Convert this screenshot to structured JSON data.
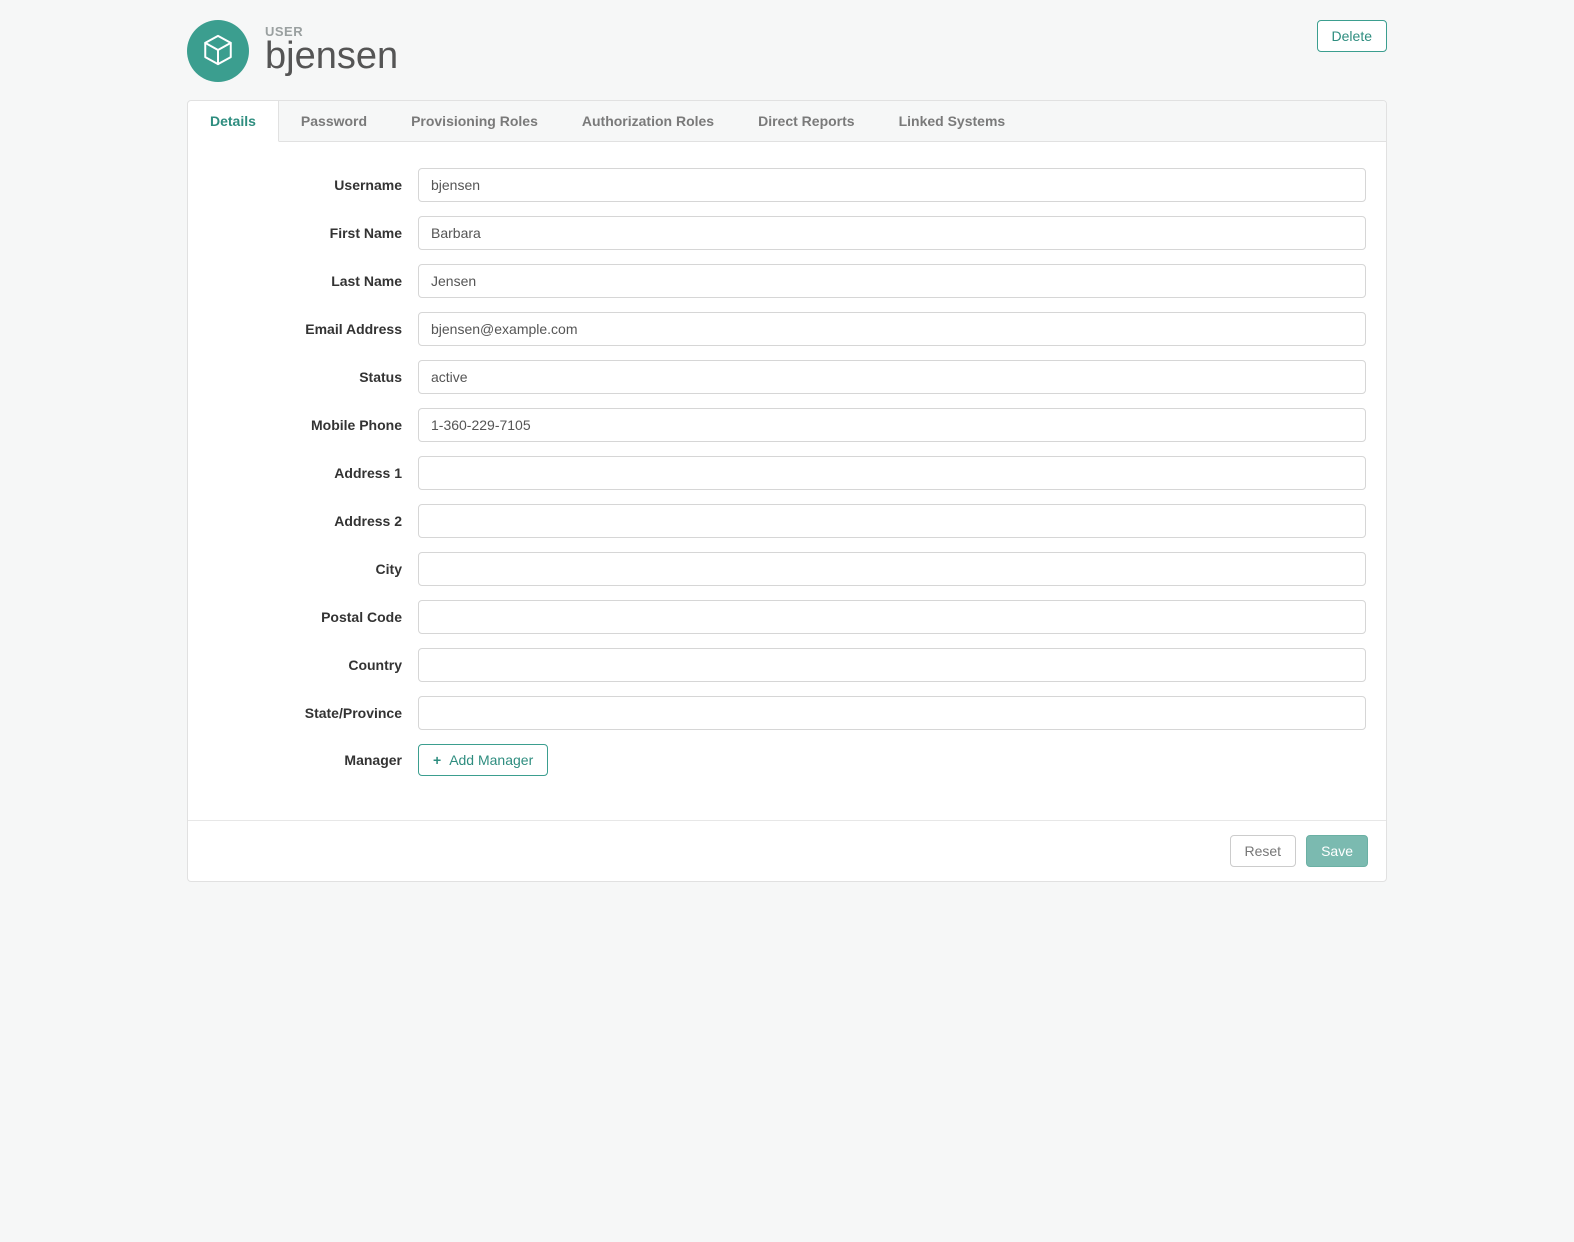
{
  "header": {
    "entity_type": "USER",
    "entity_name": "bjensen",
    "delete_label": "Delete"
  },
  "tabs": [
    {
      "label": "Details",
      "active": true
    },
    {
      "label": "Password",
      "active": false
    },
    {
      "label": "Provisioning Roles",
      "active": false
    },
    {
      "label": "Authorization Roles",
      "active": false
    },
    {
      "label": "Direct Reports",
      "active": false
    },
    {
      "label": "Linked Systems",
      "active": false
    }
  ],
  "form": {
    "fields": [
      {
        "label": "Username",
        "value": "bjensen"
      },
      {
        "label": "First Name",
        "value": "Barbara"
      },
      {
        "label": "Last Name",
        "value": "Jensen"
      },
      {
        "label": "Email Address",
        "value": "bjensen@example.com"
      },
      {
        "label": "Status",
        "value": "active"
      },
      {
        "label": "Mobile Phone",
        "value": "1-360-229-7105"
      },
      {
        "label": "Address 1",
        "value": ""
      },
      {
        "label": "Address 2",
        "value": ""
      },
      {
        "label": "City",
        "value": ""
      },
      {
        "label": "Postal Code",
        "value": ""
      },
      {
        "label": "Country",
        "value": ""
      },
      {
        "label": "State/Province",
        "value": ""
      }
    ],
    "manager_label": "Manager",
    "add_manager_label": "Add Manager"
  },
  "footer": {
    "reset_label": "Reset",
    "save_label": "Save"
  }
}
